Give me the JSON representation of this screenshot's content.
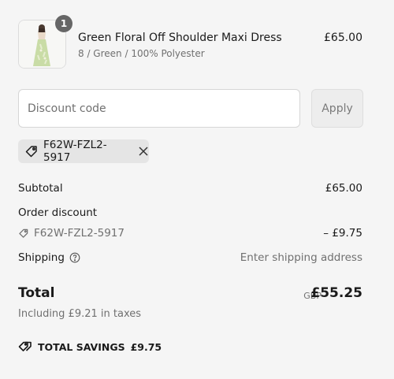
{
  "product": {
    "name": "Green Floral Off Shoulder Maxi Dress",
    "variant": "8 / Green / 100% Polyester",
    "price": "£65.00",
    "quantity": "1"
  },
  "discount": {
    "placeholder": "Discount code",
    "apply_label": "Apply",
    "applied_code": "F62W-FZL2-5917"
  },
  "summary": {
    "subtotal_label": "Subtotal",
    "subtotal_value": "£65.00",
    "order_discount_label": "Order discount",
    "discount_code": "F62W-FZL2-5917",
    "discount_value": "– £9.75",
    "shipping_label": "Shipping",
    "shipping_value": "Enter shipping address",
    "total_label": "Total",
    "currency": "GBP",
    "total_value": "£55.25",
    "taxes_text": "Including £9.21 in taxes",
    "savings_label": "TOTAL SAVINGS",
    "savings_value": "£9.75"
  }
}
